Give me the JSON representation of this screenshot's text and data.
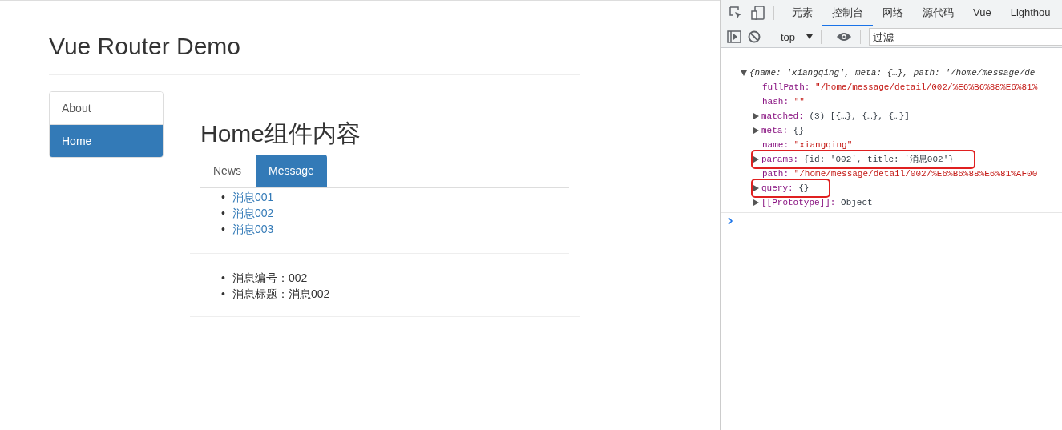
{
  "app": {
    "title": "Vue Router Demo",
    "nav": [
      {
        "label": "About",
        "selected": false
      },
      {
        "label": "Home",
        "selected": true
      }
    ],
    "heading": "Home组件内容",
    "tabs": [
      {
        "label": "News",
        "selected": false
      },
      {
        "label": "Message",
        "selected": true
      }
    ],
    "messages": [
      "消息001",
      "消息002",
      "消息003"
    ],
    "detail": [
      "消息编号：002",
      "消息标题：消息002"
    ],
    "bullet": "•"
  },
  "devtools": {
    "tabs": [
      {
        "label": "元素",
        "selected": false
      },
      {
        "label": "控制台",
        "selected": true
      },
      {
        "label": "网络",
        "selected": false
      },
      {
        "label": "源代码",
        "selected": false
      },
      {
        "label": "Vue",
        "selected": false
      },
      {
        "label": "Lighthou",
        "selected": false
      }
    ],
    "context": "top",
    "filter_placeholder": "过滤",
    "summary": "{name: 'xiangqing', meta: {…}, path: '/home/message/de",
    "properties": [
      {
        "key": "fullPath:",
        "value": "\"/home/message/detail/002/%E6%B6%88%E6%81%",
        "kind": "string",
        "expandable": false,
        "highlighted": false
      },
      {
        "key": "hash:",
        "value": "\"\"",
        "kind": "string",
        "expandable": false,
        "highlighted": false
      },
      {
        "key": "matched:",
        "value": "(3) [{…}, {…}, {…}]",
        "kind": "object",
        "expandable": true,
        "highlighted": false
      },
      {
        "key": "meta:",
        "value": "{}",
        "kind": "object",
        "expandable": true,
        "highlighted": false
      },
      {
        "key": "name:",
        "value": "\"xiangqing\"",
        "kind": "string",
        "expandable": false,
        "highlighted": false
      },
      {
        "key": "params:",
        "value": "{id: '002', title: '消息002'}",
        "kind": "params",
        "expandable": true,
        "highlighted": true
      },
      {
        "key": "path:",
        "value": "\"/home/message/detail/002/%E6%B6%88%E6%81%AF00",
        "kind": "string",
        "expandable": false,
        "highlighted": false
      },
      {
        "key": "query:",
        "value": "{}",
        "kind": "object",
        "expandable": true,
        "highlighted": true
      },
      {
        "key": "[[Prototype]]:",
        "value": "Object",
        "kind": "object",
        "expandable": true,
        "highlighted": false
      }
    ]
  }
}
